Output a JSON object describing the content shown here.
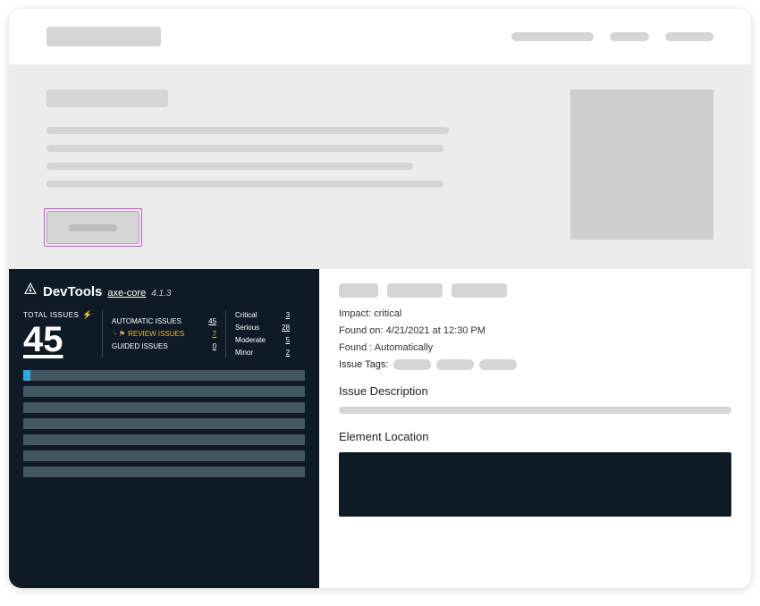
{
  "devtools": {
    "title": "DevTools",
    "axecore_label": "axe-core",
    "version": "4.1.3",
    "total_issues_label": "TOTAL ISSUES",
    "total_issues": "45",
    "issue_types": {
      "automatic": {
        "label": "AUTOMATIC ISSUES",
        "count": "45"
      },
      "review": {
        "label": "REVIEW ISSUES",
        "count": "7"
      },
      "guided": {
        "label": "GUIDED ISSUES",
        "count": "0"
      }
    },
    "severity": {
      "critical": {
        "label": "Critical",
        "count": "3"
      },
      "serious": {
        "label": "Serious",
        "count": "28"
      },
      "moderate": {
        "label": "Moderate",
        "count": "5"
      },
      "minor": {
        "label": "Minor",
        "count": "2"
      }
    }
  },
  "detail": {
    "impact_label": "Impact:",
    "impact_value": "critical",
    "found_on_label": "Found on:",
    "found_on_value": "4/21/2021 at 12:30 PM",
    "found_label": "Found :",
    "found_value": "Automatically",
    "issue_tags_label": "Issue Tags:",
    "issue_description_heading": "Issue Description",
    "element_location_heading": "Element Location"
  }
}
